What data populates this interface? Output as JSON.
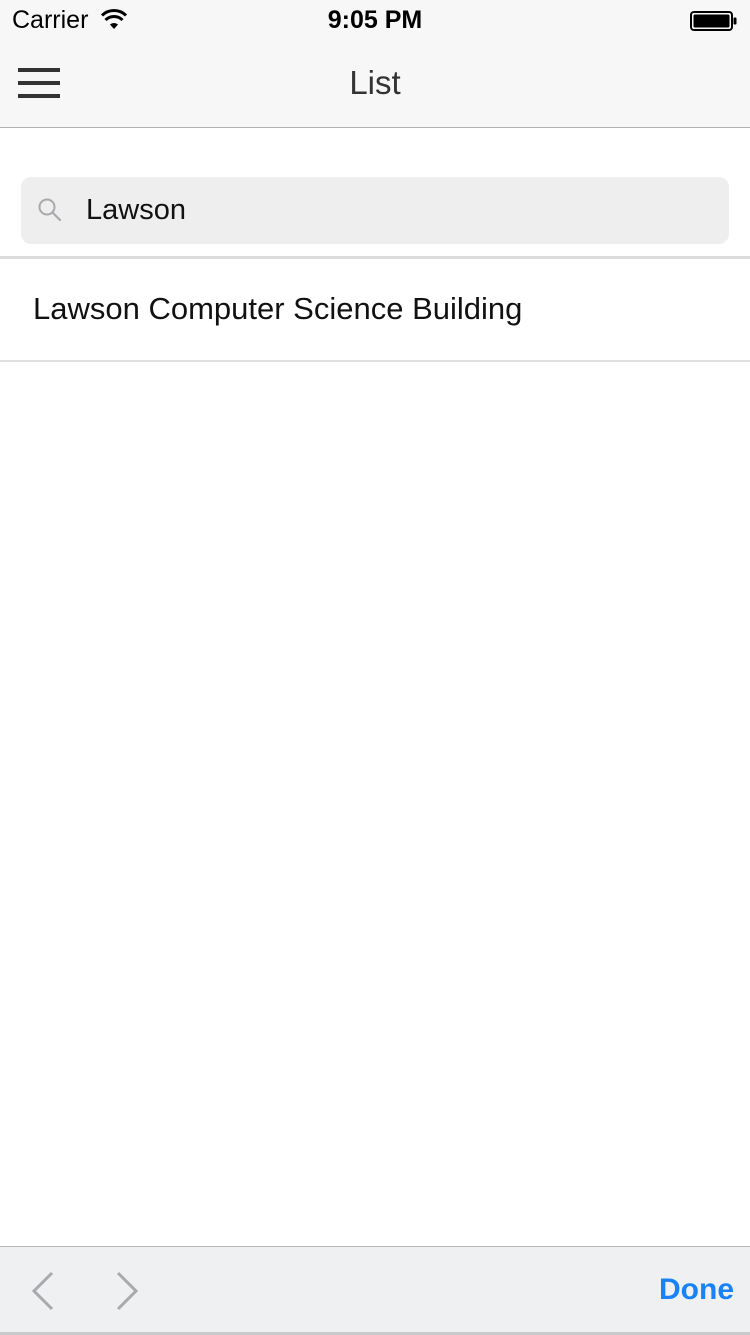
{
  "status_bar": {
    "carrier": "Carrier",
    "time": "9:05 PM",
    "wifi_icon": "wifi-icon",
    "battery_icon": "battery-icon"
  },
  "nav": {
    "title": "List",
    "menu_icon": "hamburger-menu-icon"
  },
  "search": {
    "value": "Lawson",
    "icon": "search-icon"
  },
  "results": [
    {
      "label": "Lawson Computer Science Building"
    }
  ],
  "toolbar": {
    "prev_icon": "chevron-left-icon",
    "next_icon": "chevron-right-icon",
    "done_label": "Done"
  },
  "colors": {
    "accent": "#1a82f7",
    "bar_background": "#f7f7f7",
    "toolbar_background": "#eff0f2"
  }
}
